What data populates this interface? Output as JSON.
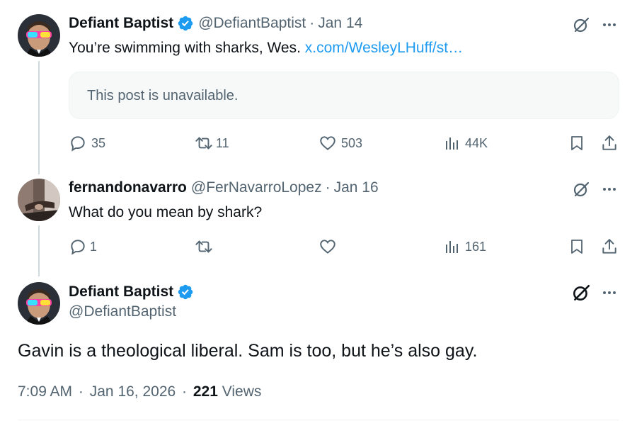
{
  "colors": {
    "link": "#1d9bf0",
    "muted": "#536471",
    "verified": "#1d9bf0",
    "thread_line": "#cfd9de"
  },
  "tweet1": {
    "author": "Defiant Baptist",
    "handle": "@DefiantBaptist",
    "sep": "·",
    "date": "Jan 14",
    "text": "You’re swimming with sharks, Wes. ",
    "link": "x.com/WesleyLHuff/st…",
    "quote": "This post is unavailable.",
    "replies": "35",
    "reposts": "11",
    "likes": "503",
    "views": "44K",
    "icons": [
      "verified-badge-icon",
      "grok-icon",
      "more-icon",
      "reply-icon",
      "repost-icon",
      "like-icon",
      "views-icon",
      "bookmark-icon",
      "share-icon"
    ]
  },
  "tweet2": {
    "author": "fernandonavarro",
    "handle": "@FerNavarroLopez",
    "sep": "·",
    "date": "Jan 16",
    "text": "What do you mean by shark?",
    "replies": "1",
    "views": "161"
  },
  "main": {
    "author": "Defiant Baptist",
    "handle": "@DefiantBaptist",
    "text": "Gavin is a theological liberal. Sam is too, but he’s also gay.",
    "time": "7:09 AM",
    "sep1": "·",
    "date": "Jan 16, 2026",
    "sep2": "·",
    "views": "221",
    "views_label": " Views"
  }
}
